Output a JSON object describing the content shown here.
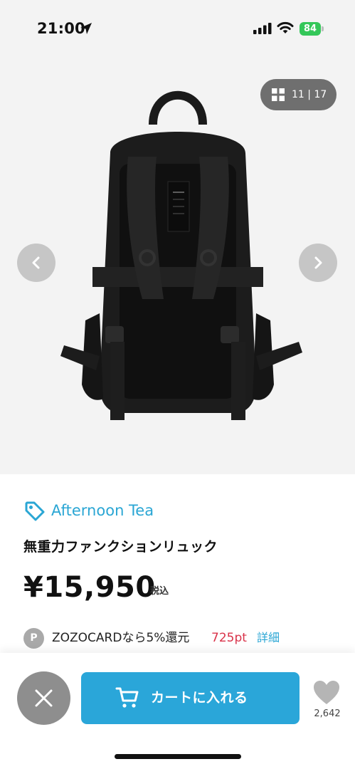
{
  "status_bar": {
    "time": "21:00",
    "battery": "84",
    "icons": [
      "location-arrow-icon",
      "signal-icon",
      "wifi-icon",
      "battery-icon"
    ]
  },
  "gallery": {
    "current": "11",
    "separator": "|",
    "total": "17",
    "icons": [
      "grid-icon",
      "chevron-left-icon",
      "chevron-right-icon"
    ]
  },
  "product": {
    "brand": "Afternoon Tea",
    "name": "無重力ファンクションリュック",
    "price": "¥15,950",
    "tax_label": "税込"
  },
  "points": {
    "badge": "P",
    "text": "ZOZOCARDなら5%還元",
    "value": "725pt",
    "detail_link": "詳細"
  },
  "bottom_bar": {
    "cart_label": "カートに入れる",
    "favorite_count": "2,642"
  },
  "colors": {
    "accent": "#2aa6d9",
    "points_red": "#d9334a",
    "battery_green": "#34c759",
    "image_background": "#f3f3f3"
  }
}
